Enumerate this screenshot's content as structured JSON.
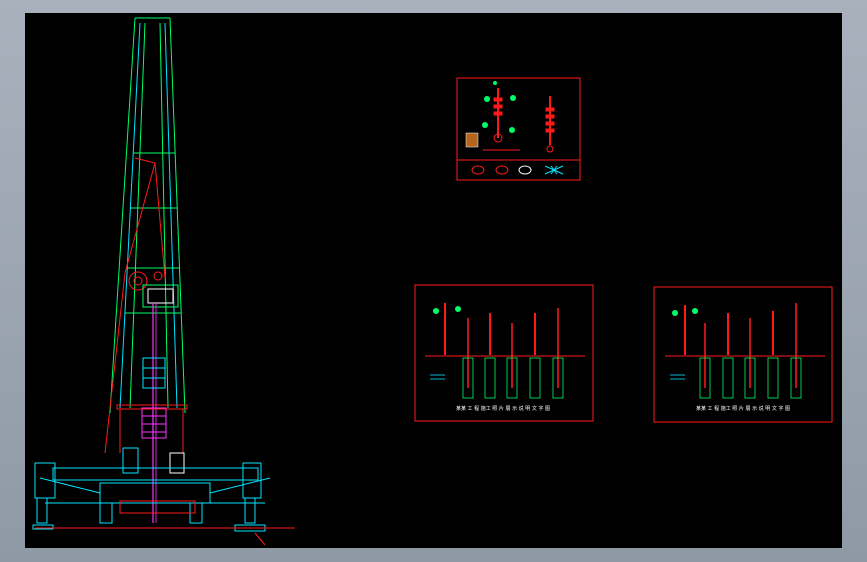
{
  "colors": {
    "background": "#000000",
    "frame": "#9aa3ae",
    "red": "#ff1a1a",
    "green": "#00ff66",
    "cyan": "#00e5ff",
    "magenta": "#ff33ff",
    "white": "#ffffff",
    "yellow": "#ffd400"
  },
  "panel_a": {
    "legend_icons": [
      "ring-symbol",
      "double-ring-symbol",
      "oval-symbol",
      "cross-hatch-symbol"
    ]
  },
  "panel_b": {
    "caption": "某某 工 程 施工 照 片 展 示 说 明 文 字 图"
  },
  "panel_c": {
    "caption": "某某 工 程 施工 照 片 展 示 说 明 文 字 图"
  }
}
